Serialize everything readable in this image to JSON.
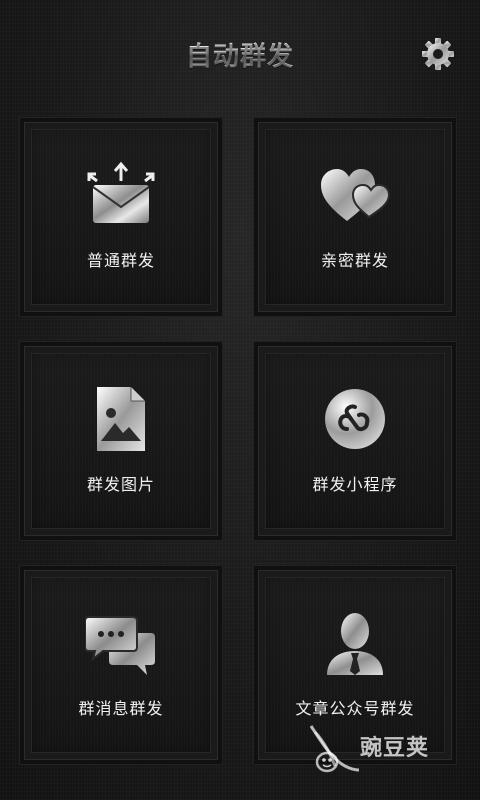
{
  "header": {
    "title": "自动群发",
    "settings_icon": "gear-icon"
  },
  "tiles": [
    {
      "label": "普通群发",
      "icon": "envelope-share-icon"
    },
    {
      "label": "亲密群发",
      "icon": "hearts-icon"
    },
    {
      "label": "群发图片",
      "icon": "image-file-icon"
    },
    {
      "label": "群发小程序",
      "icon": "mini-program-icon"
    },
    {
      "label": "群消息群发",
      "icon": "chat-bubbles-icon"
    },
    {
      "label": "文章公众号群发",
      "icon": "official-account-icon"
    }
  ],
  "watermark": {
    "text": "豌豆荚",
    "icon": "pea-pod-logo-icon"
  },
  "colors": {
    "background": "#161616",
    "tile_border": "#2c2c2c",
    "text": "#f0f0f0"
  }
}
